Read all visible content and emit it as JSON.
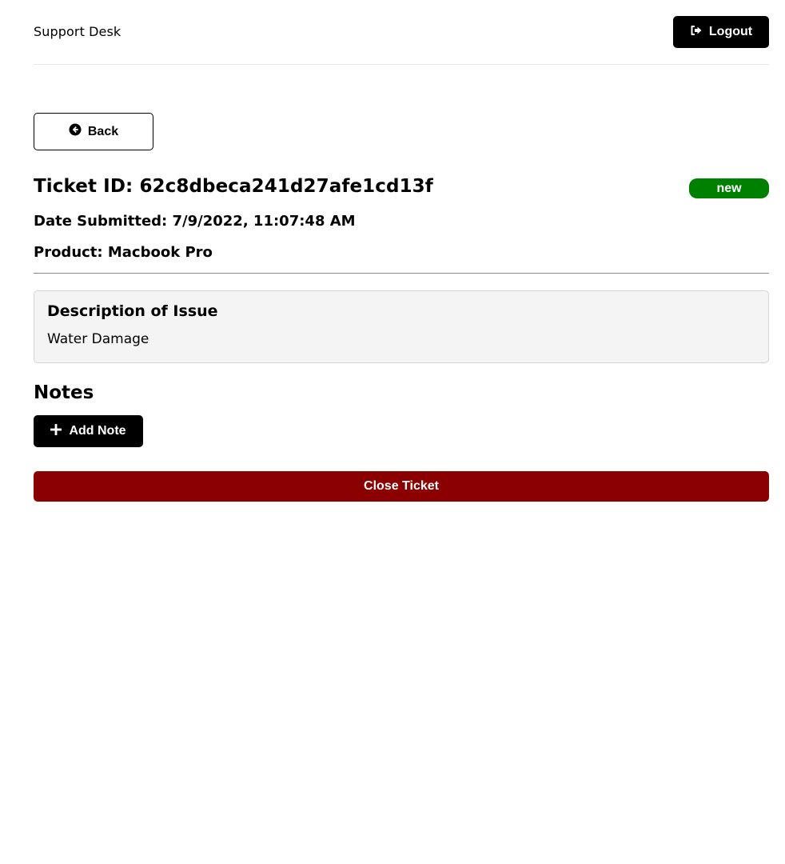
{
  "header": {
    "brand": "Support Desk",
    "logout_label": "Logout"
  },
  "nav": {
    "back_label": "Back"
  },
  "ticket": {
    "id_line": "Ticket ID: 62c8dbeca241d27afe1cd13f",
    "status": "new",
    "date_line": "Date Submitted: 7/9/2022, 11:07:48 AM",
    "product_line": "Product: Macbook Pro"
  },
  "description": {
    "heading": "Description of Issue",
    "text": "Water Damage"
  },
  "notes": {
    "heading": "Notes",
    "add_label": "Add Note"
  },
  "actions": {
    "close_label": "Close Ticket"
  },
  "colors": {
    "status_new": "#008000",
    "close_button": "#8b0000",
    "primary_button": "#000000"
  },
  "icons": {
    "logout": "sign-out-icon",
    "back": "arrow-circle-left-icon",
    "add": "plus-icon"
  }
}
